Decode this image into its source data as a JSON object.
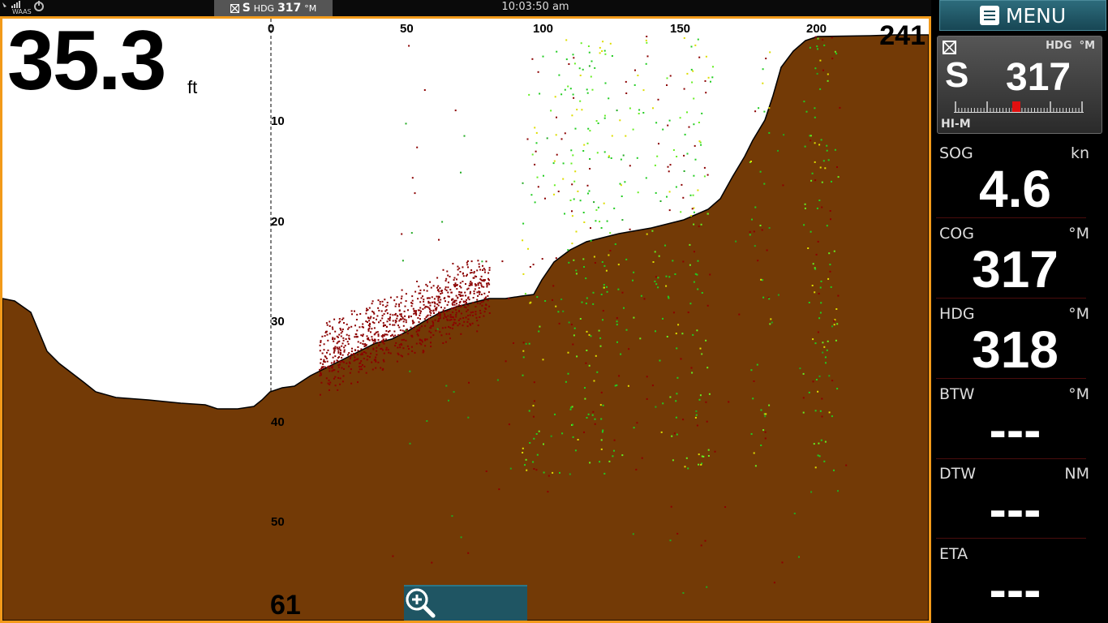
{
  "status_bar": {
    "gps_label": "WAAS",
    "heading_prefix": "S",
    "heading_label": "HDG",
    "heading_value": "317",
    "heading_unit": "°M",
    "time": "10:03:50 am"
  },
  "sonar": {
    "depth_value": "35.3",
    "depth_unit": "ft",
    "range_top": "241",
    "range_bottom": "61",
    "horizontal_ticks": [
      "0",
      "50",
      "100",
      "150",
      "200"
    ],
    "depth_ticks": [
      "10",
      "20",
      "30",
      "40",
      "50"
    ],
    "colors": {
      "bottom": "#733a06",
      "water": "#ffffff",
      "frame": "#f29a1a",
      "fish": "#8b0000"
    }
  },
  "zoom": {
    "zoom_out_icon": "zoom-out-icon",
    "zoom_in_icon": "zoom-in-icon"
  },
  "menu": {
    "label": "MENU"
  },
  "compass": {
    "direction": "S",
    "value": "317",
    "label": "HDG",
    "unit": "°M",
    "mode": "HI-M"
  },
  "data_boxes": [
    {
      "label": "SOG",
      "unit": "kn",
      "value": "4.6"
    },
    {
      "label": "COG",
      "unit": "°M",
      "value": "317"
    },
    {
      "label": "HDG",
      "unit": "°M",
      "value": "318"
    },
    {
      "label": "BTW",
      "unit": "°M",
      "value": "---"
    },
    {
      "label": "DTW",
      "unit": "NM",
      "value": "---"
    },
    {
      "label": "ETA",
      "unit": "",
      "value": "---"
    }
  ]
}
